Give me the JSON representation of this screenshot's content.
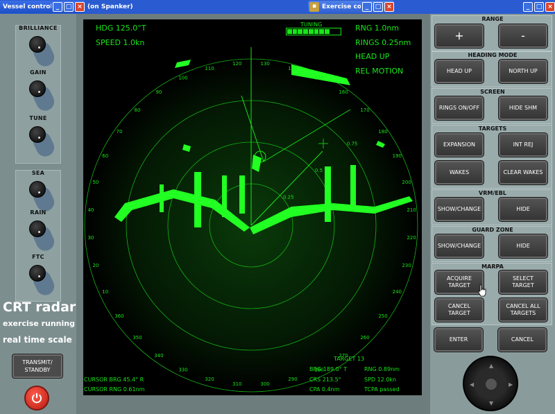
{
  "windows": {
    "vessel_control": "Vessel control",
    "spanker": "(on Spanker)",
    "exercise": "Exercise cont..."
  },
  "knobs": [
    "BRILLIANCE",
    "GAIN",
    "TUNE",
    "SEA",
    "RAIN",
    "FTC"
  ],
  "status": {
    "line1": "CRT radar",
    "line2": "exercise running",
    "line3": "real time scale"
  },
  "transmit": {
    "label_line1": "TRANSMIT/",
    "label_line2": "STANDBY"
  },
  "power_icon": "power-icon",
  "radar": {
    "hdg": "HDG 125.0°T",
    "speed": "SPEED  1.0kn",
    "tuning": "TUNING",
    "tuning_level": 0.8,
    "rng": "RNG 1.0nm",
    "rings": "RINGS 0.25nm",
    "head_up": "HEAD UP",
    "rel_motion": "REL MOTION",
    "cursor_brg": "CURSOR BRG  45.4° R",
    "cursor_rng": "CURSOR RNG  0.61nm",
    "target_title": "TARGET 13",
    "brg": "BRG 189.0° T",
    "rng_t": "RNG  0.89nm",
    "crs": "CRS 213.5°",
    "spd": "SPD  12.0kn",
    "cpa": "CPA   0.4nm",
    "tcpa": "TCPA passed",
    "ring_labels": [
      "0.25",
      "0.5",
      "0.75"
    ],
    "bearings": [
      "10",
      "20",
      "30",
      "40",
      "50",
      "60",
      "70",
      "80",
      "90",
      "100",
      "110",
      "120",
      "130",
      "140",
      "150",
      "160",
      "170",
      "180",
      "190",
      "200",
      "210",
      "220",
      "230",
      "240",
      "250",
      "260",
      "270",
      "280",
      "290",
      "300",
      "310",
      "320",
      "330",
      "340",
      "350",
      "360"
    ]
  },
  "panel": {
    "range": {
      "title": "RANGE",
      "plus": "+",
      "minus": "-"
    },
    "heading_mode": {
      "title": "HEADING MODE",
      "head_up": "HEAD UP",
      "north_up": "NORTH UP"
    },
    "screen": {
      "title": "SCREEN",
      "rings": "RINGS ON/OFF",
      "hide_shm": "HIDE SHM"
    },
    "targets": {
      "title": "TARGETS",
      "expansion": "EXPANSION",
      "int_rej": "INT REJ",
      "wakes": "WAKES",
      "clear_wakes": "CLEAR WAKES"
    },
    "vrm": {
      "title": "VRM/EBL",
      "show": "SHOW/CHANGE",
      "hide": "HIDE"
    },
    "guard": {
      "title": "GUARD ZONE",
      "show": "SHOW/CHANGE",
      "hide": "HIDE"
    },
    "marpa": {
      "title": "MARPA",
      "acquire_1": "ACQUIRE",
      "acquire_2": "TARGET",
      "select_1": "SELECT",
      "select_2": "TARGET",
      "cancel_1": "CANCEL",
      "cancel_2": "TARGET",
      "cancel_all_1": "CANCEL ALL",
      "cancel_all_2": "TARGETS"
    },
    "enter": "ENTER",
    "cancel": "CANCEL"
  }
}
